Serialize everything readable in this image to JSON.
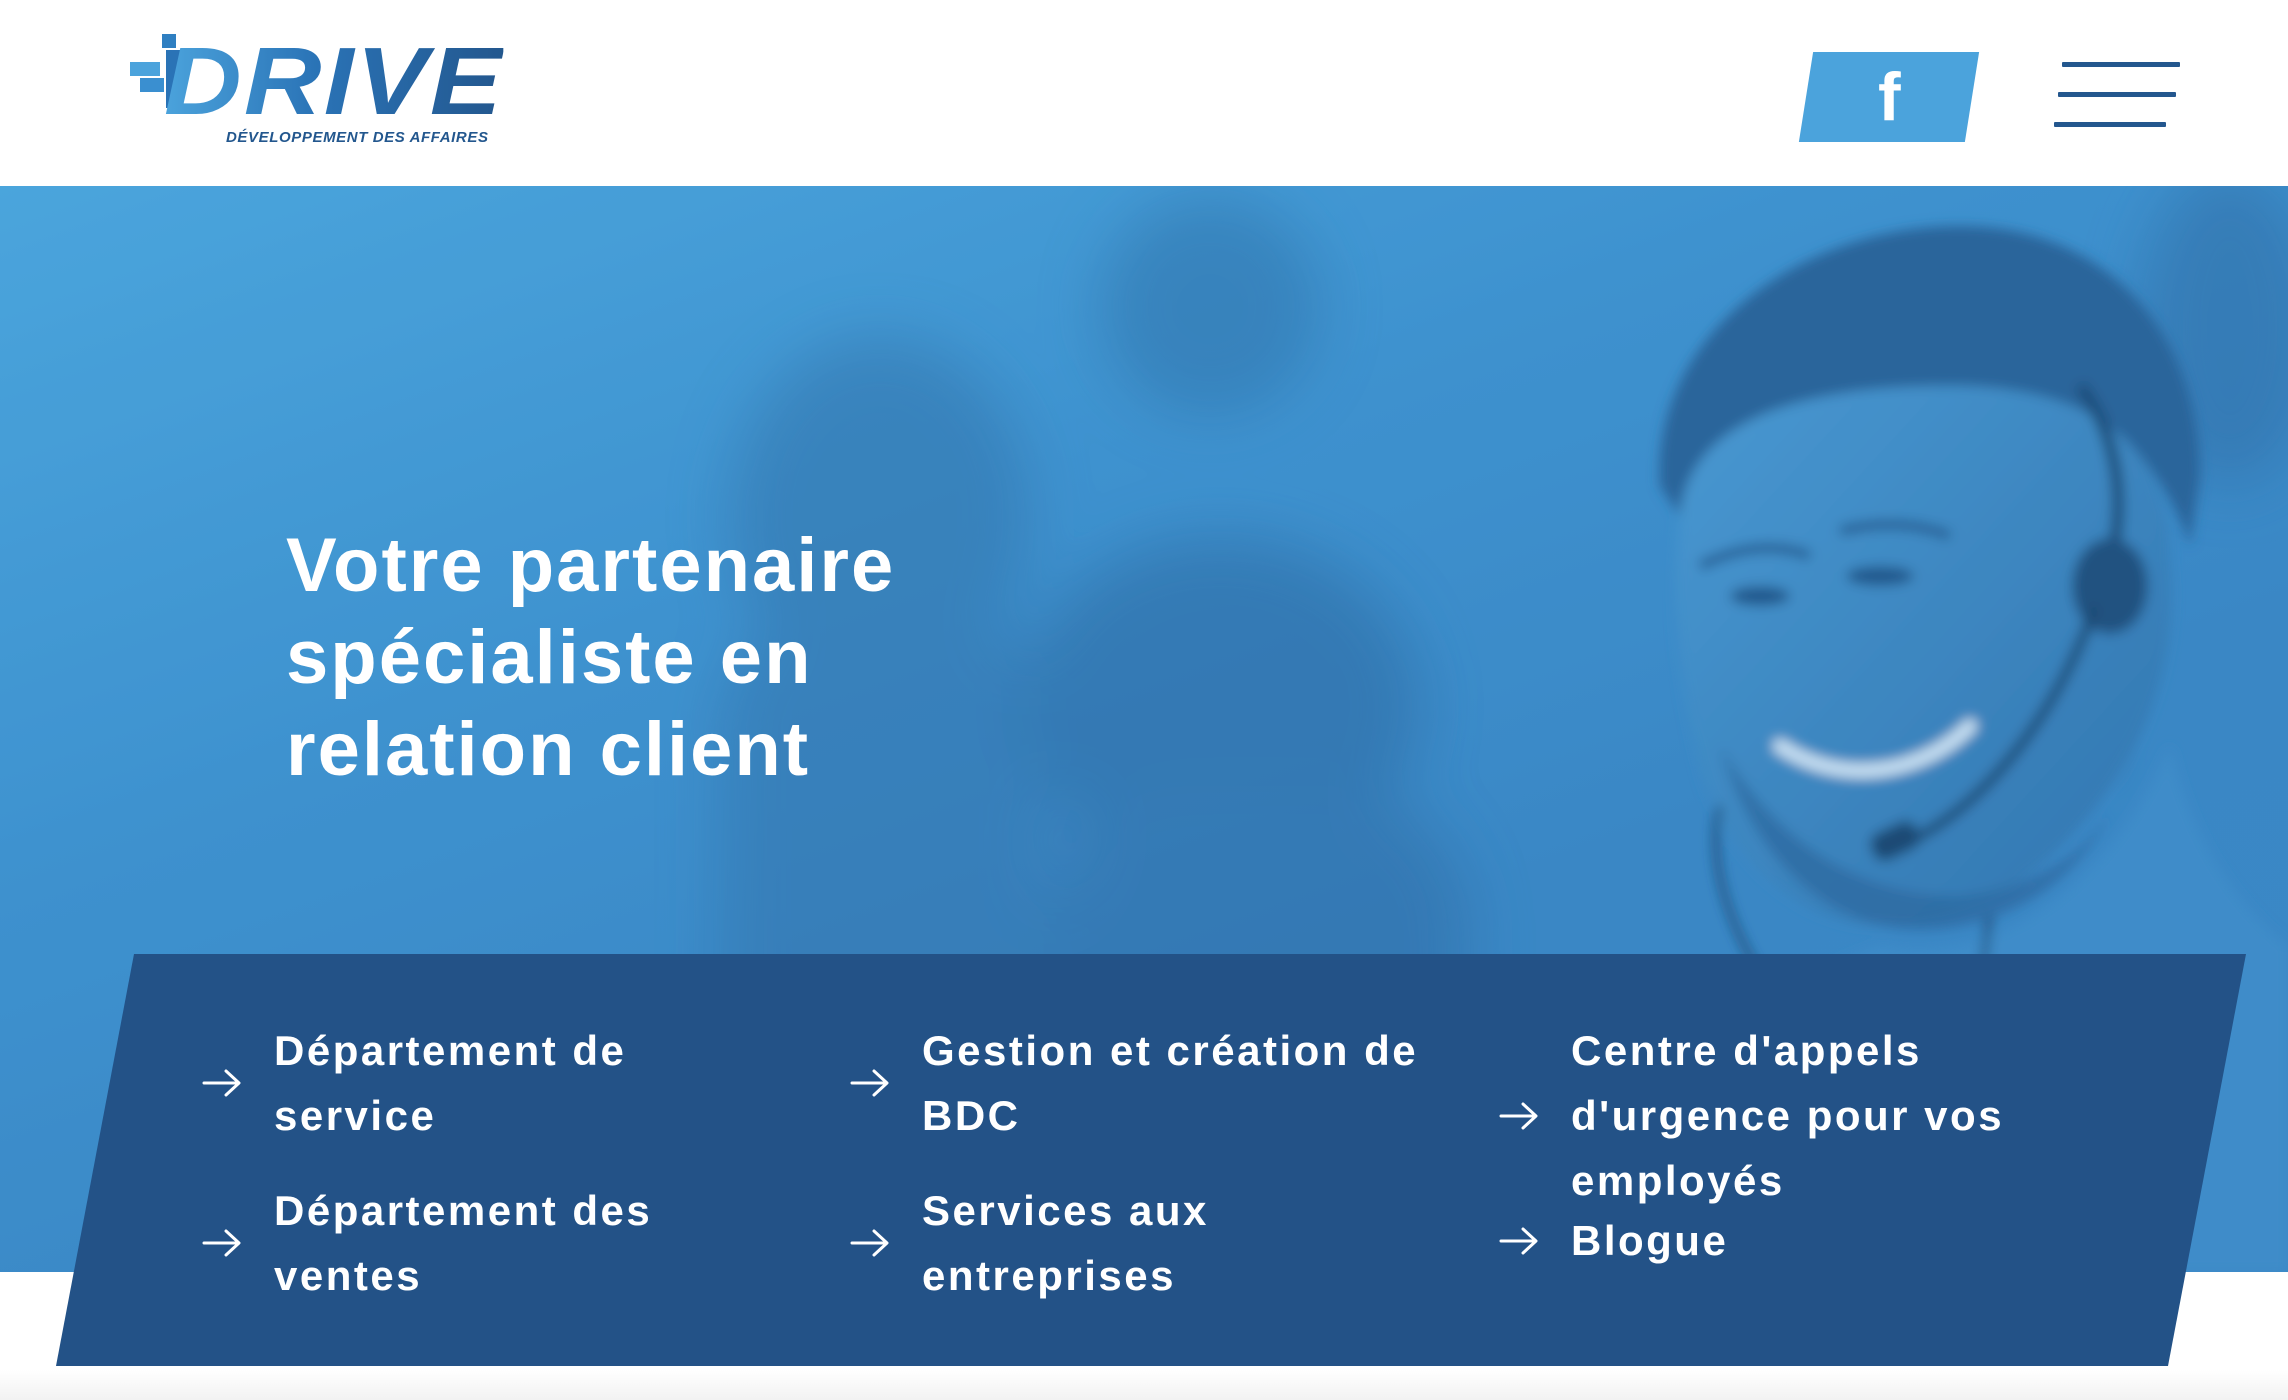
{
  "brand": {
    "name": "DRIVE",
    "tagline": "DÉVELOPPEMENT DES AFFAIRES"
  },
  "header": {
    "facebook_icon": "facebook-icon",
    "facebook_glyph": "f",
    "menu_icon": "hamburger-menu-icon"
  },
  "hero": {
    "title_lines": [
      "Votre partenaire",
      "spécialiste en",
      "relation client"
    ]
  },
  "services": [
    {
      "label": "Département de service",
      "icon": "arrow-right-icon"
    },
    {
      "label": "Département des ventes",
      "icon": "arrow-right-icon"
    },
    {
      "label": "Gestion et création de BDC",
      "icon": "arrow-right-icon"
    },
    {
      "label": "Services aux entreprises",
      "icon": "arrow-right-icon"
    },
    {
      "label": "Centre d'appels d'urgence pour vos employés",
      "icon": "arrow-right-icon"
    },
    {
      "label": "Blogue",
      "icon": "arrow-right-icon"
    }
  ],
  "colors": {
    "brand_dark": "#23578e",
    "brand_light": "#4ba3dc",
    "panel": "#235287",
    "hero_overlay": "#3f90cc",
    "white": "#ffffff"
  }
}
